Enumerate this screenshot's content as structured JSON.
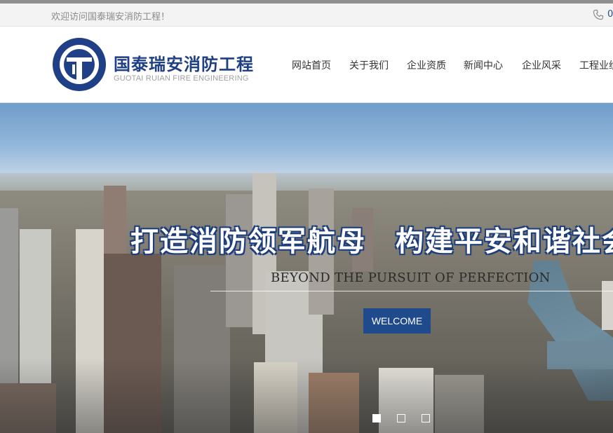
{
  "top_bar": {
    "welcome_text": "欢迎访问国泰瑞安消防工程！",
    "phone_text": "0",
    "phone_icon": "phone-icon"
  },
  "header": {
    "logo_cn": "国泰瑞安消防工程",
    "logo_en": "GUOTAI RUIAN FIRE ENGINEERING",
    "logo_letters": "GT",
    "brand_color": "#1f3f86",
    "nav": [
      {
        "label": "网站首页"
      },
      {
        "label": "关于我们"
      },
      {
        "label": "企业资质"
      },
      {
        "label": "新闻中心"
      },
      {
        "label": "企业风采"
      },
      {
        "label": "工程业绩"
      }
    ]
  },
  "banner": {
    "headline": "打造消防领军航母　构建平安和谐社会",
    "subtitle": "BEYOND THE PURSUIT OF PERFECTION",
    "button_label": "WELCOME",
    "button_color": "#1f4a8c",
    "slides": [
      {
        "active": true
      },
      {
        "active": false
      },
      {
        "active": false
      }
    ]
  }
}
